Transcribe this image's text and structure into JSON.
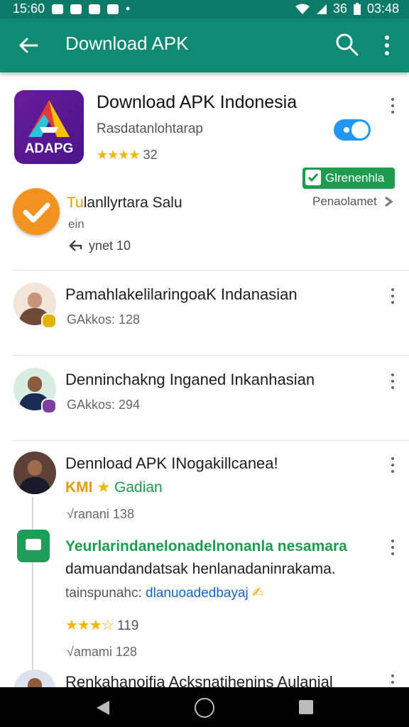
{
  "status_bar": {
    "time": "15:60",
    "right_text": "36",
    "clock": "03:48"
  },
  "appbar": {
    "title": "Download APK"
  },
  "app_card": {
    "title": "Download APK Indonesia",
    "subtitle": "Rasdatanlohtarap",
    "rating_stars": "★★★★",
    "rating_count": "32",
    "icon_text": "ADAPG",
    "toggle_on": true
  },
  "badge": {
    "label": "Glrenenhla"
  },
  "verify_row": {
    "title_part_1": "Tu",
    "title_part_2": "lanllyrtara Salu",
    "subtitle": "ein",
    "count": "ynet  10",
    "right_label": "Penaolamet"
  },
  "list_items": [
    {
      "title": "PamahlakelilaringoaK Indanasian",
      "subtitle": "GAkkos: 128"
    },
    {
      "title": "Denninchakng Inganed Inkanhasian",
      "subtitle": "GAkkos: 294"
    }
  ],
  "post": {
    "title": "Dennload APK INogakillcanea!",
    "author": "KMI",
    "author_tag": "Gadian",
    "meta": "√ranani 138"
  },
  "comment": {
    "line1": "Yeurlarindanelonadelnonanla nesamara",
    "line2": "damuandandatsak henlanadaninrakama.",
    "line3_prefix": "tainspunahc:",
    "line3_link": "dlanuoadedbayaj",
    "rating_stars": "★★★☆",
    "rating_count": "119",
    "meta": "√amami 128"
  },
  "last_item": {
    "title": "Renkahanoifia Acksnatihenins Aulanial"
  },
  "colors": {
    "primary": "#0f8a73",
    "accent": "#2196f3",
    "star": "#f4b400",
    "badge": "#1e9b4e",
    "verify": "#f29321"
  }
}
